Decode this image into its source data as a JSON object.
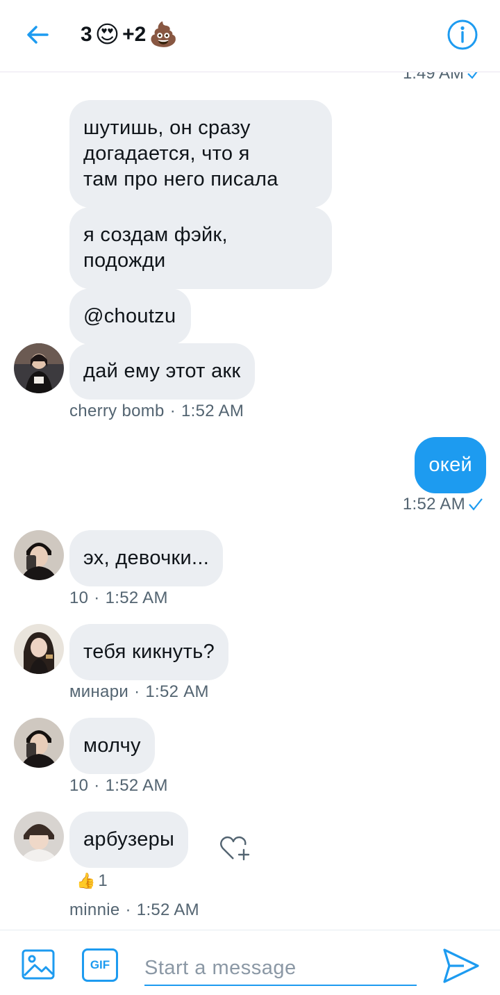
{
  "header": {
    "title_prefix": "3",
    "emoji_1": "😍",
    "title_middle": "+2",
    "emoji_2": "💩"
  },
  "messages": {
    "partial_timestamp": "1:49 AM",
    "m1": "шутишь, он сразу\nдогадается, что я\nтам про него писала",
    "m2": "я создам фэйк,\nподожди",
    "m3": "@choutzu",
    "m4": "дай ему этот акк",
    "m4_author": "cherry bomb",
    "m4_time": "1:52 AM",
    "m5": "окей",
    "m5_time": "1:52 AM",
    "m6": "эх, девочки...",
    "m6_author": "10",
    "m6_time": "1:52 AM",
    "m7": "тебя кикнуть?",
    "m7_author": "минари",
    "m7_time": "1:52 AM",
    "m8": "молчу",
    "m8_author": "10",
    "m8_time": "1:52 AM",
    "m9": "арбузеры",
    "m9_author": "minnie",
    "m9_time": "1:52 AM",
    "m9_reaction_emoji": "👍",
    "m9_reaction_count": "1",
    "separator": "·"
  },
  "composer": {
    "placeholder": "Start a message",
    "gif_label": "GIF"
  },
  "colors": {
    "accent": "#1d9bf0",
    "incoming_bubble": "#ebeef2",
    "meta_text": "#536471"
  }
}
